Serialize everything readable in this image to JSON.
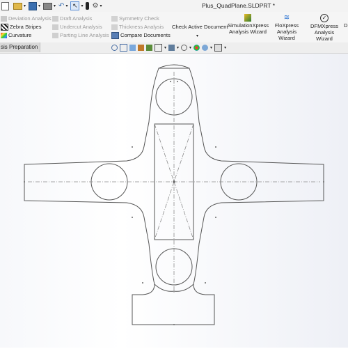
{
  "window": {
    "title": "Plus_QuadPlane.SLDPRT *"
  },
  "ribbon": {
    "col1": [
      {
        "label": "Deviation Analysis",
        "enabled": false,
        "icon": "deviation-analysis-icon"
      },
      {
        "label": "Zebra Stripes",
        "enabled": true,
        "icon": "zebra-stripes-icon"
      },
      {
        "label": "Curvature",
        "enabled": true,
        "icon": "curvature-icon"
      }
    ],
    "col2": [
      {
        "label": "Draft Analysis",
        "enabled": false,
        "icon": "draft-analysis-icon"
      },
      {
        "label": "Undercut Analysis",
        "enabled": false,
        "icon": "undercut-analysis-icon"
      },
      {
        "label": "Parting Line Analysis",
        "enabled": false,
        "icon": "parting-line-analysis-icon"
      }
    ],
    "col3": [
      {
        "label": "Symmetry Check",
        "enabled": false,
        "icon": "symmetry-check-icon"
      },
      {
        "label": "Thickness Analysis",
        "enabled": false,
        "icon": "thickness-analysis-icon"
      },
      {
        "label": "Compare Documents",
        "enabled": true,
        "icon": "compare-documents-icon"
      }
    ],
    "check_active": "Check Active Document",
    "wizards": [
      {
        "line1": "SimulationXpress",
        "line2": "Analysis Wizard",
        "icon": "simulationxpress-icon"
      },
      {
        "line1": "FloXpress",
        "line2": "Analysis Wizard",
        "icon": "floxpress-icon"
      },
      {
        "line1": "DFMXpress",
        "line2": "Analysis Wizard",
        "icon": "dfmxpress-icon"
      },
      {
        "line1": "D",
        "line2": "",
        "icon": ""
      }
    ]
  },
  "tabs": {
    "active": "sis Preparation"
  },
  "colors": {
    "accent": "#1f5fae",
    "sketch": "#555555",
    "centerline": "#8a8a8a"
  }
}
